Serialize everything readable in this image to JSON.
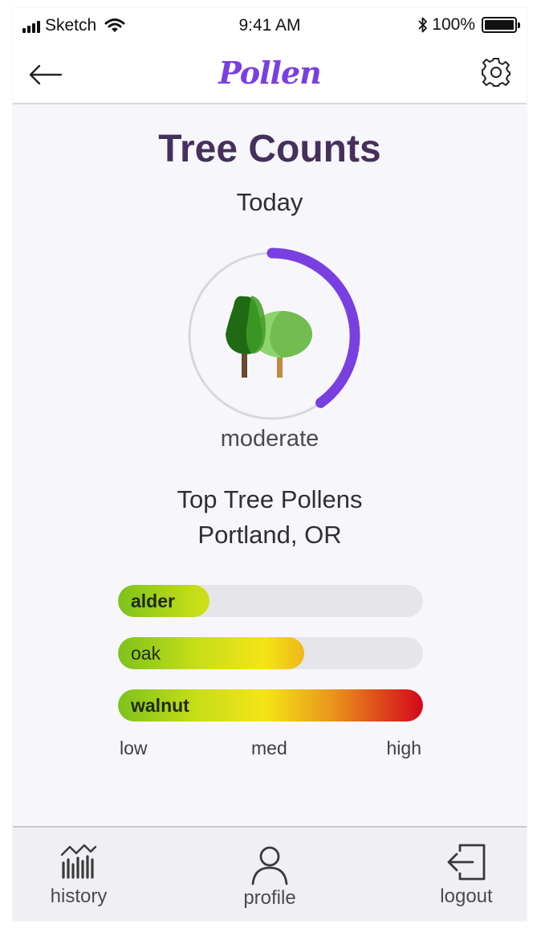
{
  "status_bar": {
    "carrier": "Sketch",
    "time": "9:41 AM",
    "battery": "100%"
  },
  "nav": {
    "logo": "Pollen",
    "icons": {
      "back": "back-arrow-icon",
      "settings": "gear-icon"
    }
  },
  "header": {
    "title": "Tree Counts",
    "subtitle": "Today"
  },
  "gauge": {
    "level_label": "moderate",
    "fill_fraction": 0.4,
    "accent_color": "#7a3fe0",
    "track_color": "#d7d7dc",
    "icon": "trees-icon"
  },
  "top_pollens": {
    "heading_line1": "Top Tree Pollens",
    "heading_line2": "Portland, OR",
    "items": [
      {
        "name": "alder",
        "level": 0.3,
        "bold": true
      },
      {
        "name": "oak",
        "level": 0.61,
        "bold": false
      },
      {
        "name": "walnut",
        "level": 1.0,
        "bold": true
      }
    ],
    "scale": {
      "low": "low",
      "med": "med",
      "high": "high"
    },
    "gradient_colors": [
      "#7dc21c",
      "#f4e517",
      "#d4061b"
    ]
  },
  "tabbar": {
    "items": [
      {
        "label": "history",
        "icon": "history-chart-icon"
      },
      {
        "label": "profile",
        "icon": "profile-icon"
      },
      {
        "label": "logout",
        "icon": "logout-icon"
      }
    ]
  }
}
